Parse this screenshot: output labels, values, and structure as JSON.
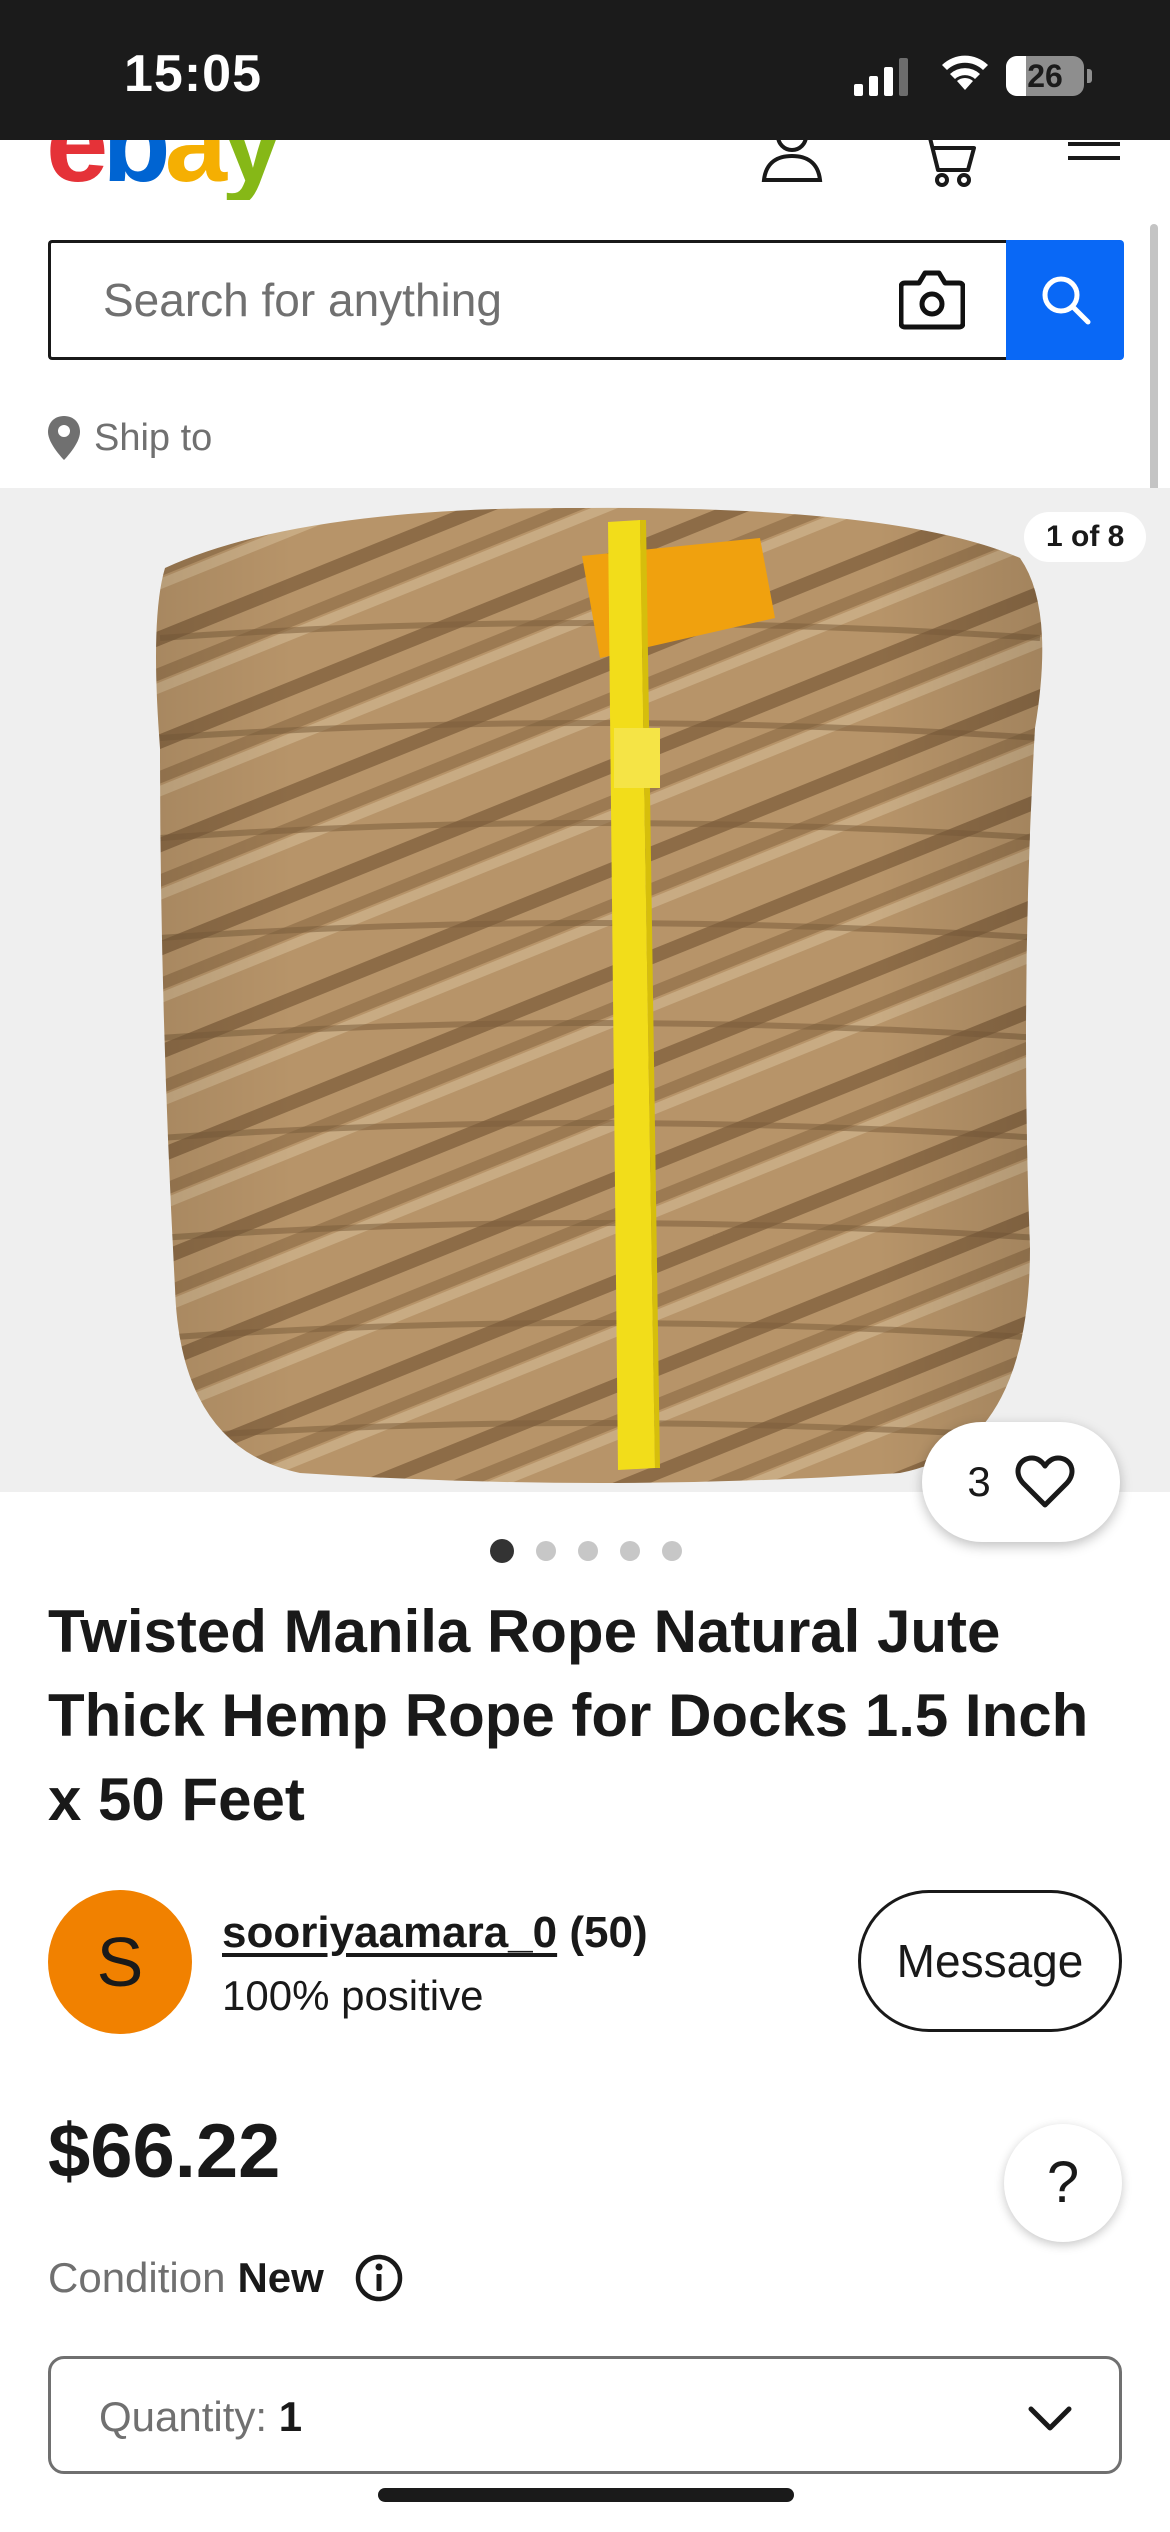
{
  "status_bar": {
    "time": "15:05",
    "battery": "26",
    "battery_level_percent": 26
  },
  "header": {
    "logo_letters": [
      "e",
      "b",
      "a",
      "y"
    ],
    "icons": [
      "account-icon",
      "cart-icon",
      "menu-icon"
    ]
  },
  "search": {
    "placeholder": "Search for anything"
  },
  "ship_to": {
    "label": "Ship to"
  },
  "gallery": {
    "counter": "1 of 8",
    "dot_count": 5,
    "active_dot": 0
  },
  "watch": {
    "count": "3"
  },
  "listing": {
    "title": "Twisted Manila Rope Natural Jute Thick Hemp Rope for Docks 1.5 Inch x 50 Feet"
  },
  "seller": {
    "avatar_letter": "S",
    "name": "sooriyaamara_0",
    "feedback_count": "(50)",
    "positive": "100% positive",
    "message_label": "Message"
  },
  "price": "$66.22",
  "help_label": "?",
  "condition": {
    "label": "Condition",
    "value": "New"
  },
  "quantity": {
    "label": "Quantity:",
    "value": "1"
  },
  "colors": {
    "accent_blue": "#0968f6",
    "avatar_orange": "#f18100",
    "rope_tan": "#b9976c",
    "strap_yellow": "#f2dd1a",
    "tape_orange": "#f0a10e"
  }
}
